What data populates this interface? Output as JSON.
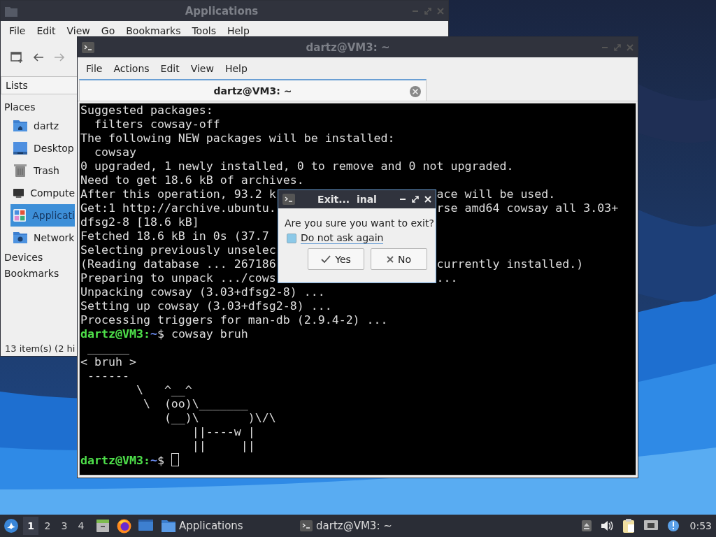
{
  "file_manager": {
    "title": "Applications",
    "menu": [
      "File",
      "Edit",
      "View",
      "Go",
      "Bookmarks",
      "Tools",
      "Help"
    ],
    "side_pane_mode": "Lists",
    "sidebar": [
      {
        "label": "Places",
        "items": [
          {
            "label": "dartz",
            "kind": "home",
            "selected": false
          },
          {
            "label": "Desktop",
            "kind": "desktop",
            "selected": false
          },
          {
            "label": "Trash",
            "kind": "trash",
            "selected": false
          },
          {
            "label": "Compute",
            "kind": "computer",
            "selected": false
          },
          {
            "label": "Applicati",
            "kind": "applications",
            "selected": true
          },
          {
            "label": "Network",
            "kind": "network",
            "selected": false
          }
        ]
      },
      {
        "label": "Devices"
      },
      {
        "label": "Bookmarks"
      }
    ],
    "status": "13 item(s) (2 hi"
  },
  "terminal": {
    "title": "dartz@VM3: ~",
    "menu": [
      "File",
      "Actions",
      "Edit",
      "View",
      "Help"
    ],
    "tabs": [
      {
        "label": "dartz@VM3: ~",
        "selected": true
      }
    ],
    "lines": [
      {
        "kind": "output",
        "text": "Suggested packages:"
      },
      {
        "kind": "output",
        "text": "  filters cowsay-off"
      },
      {
        "kind": "output",
        "text": "The following NEW packages will be installed:"
      },
      {
        "kind": "output",
        "text": "  cowsay"
      },
      {
        "kind": "output",
        "text": "0 upgraded, 1 newly installed, 0 to remove and 0 not upgraded."
      },
      {
        "kind": "output",
        "text": "Need to get 18.6 kB of archives."
      },
      {
        "kind": "output",
        "text": "After this operation, 93.2 k",
        "rest": "ace will be used."
      },
      {
        "kind": "output",
        "text": "Get:1 http://archive.ubuntu.",
        "rest": "rse amd64 cowsay all 3.03+"
      },
      {
        "kind": "output",
        "text": "dfsg2-8 [18.6 kB]"
      },
      {
        "kind": "output",
        "text": "Fetched 18.6 kB in 0s (37.7"
      },
      {
        "kind": "output",
        "text": "Selecting previously unselec"
      },
      {
        "kind": "output",
        "text": "(Reading database ... 267186",
        "rest": "currently installed.)"
      },
      {
        "kind": "output",
        "text": "Preparing to unpack .../cows",
        "rest": "..."
      },
      {
        "kind": "output",
        "text": "Unpacking cowsay (3.03+dfsg2-8) ..."
      },
      {
        "kind": "output",
        "text": "Setting up cowsay (3.03+dfsg2-8) ..."
      },
      {
        "kind": "output",
        "text": "Processing triggers for man-db (2.9.4-2) ..."
      },
      {
        "kind": "prompt",
        "user_host": "dartz@VM3:",
        "path": "~",
        "command": "$ cowsay bruh",
        "cursor": false
      },
      {
        "kind": "output",
        "text": " ______"
      },
      {
        "kind": "output",
        "text": "< bruh >"
      },
      {
        "kind": "output",
        "text": " ------"
      },
      {
        "kind": "output",
        "text": "        \\   ^__^"
      },
      {
        "kind": "output",
        "text": "         \\  (oo)\\_______"
      },
      {
        "kind": "output",
        "text": "            (__)\\       )\\/\\"
      },
      {
        "kind": "output",
        "text": "                ||----w |"
      },
      {
        "kind": "output",
        "text": "                ||     ||"
      },
      {
        "kind": "prompt",
        "user_host": "dartz@VM3:",
        "path": "~",
        "command": "$",
        "cursor": true
      }
    ]
  },
  "dialog": {
    "title": "Exit...  inal",
    "message": "Are you sure you want to exit?",
    "checkbox": {
      "label": "Do not ask again",
      "checked": false
    },
    "buttons": [
      {
        "label": "Yes",
        "kind": "yes"
      },
      {
        "label": "No",
        "kind": "no"
      }
    ]
  },
  "taskbar": {
    "workspaces": [
      {
        "label": "1",
        "selected": true
      },
      {
        "label": "2",
        "selected": false
      },
      {
        "label": "3",
        "selected": false
      },
      {
        "label": "4",
        "selected": false
      }
    ],
    "tasks": [
      {
        "label": "Applications",
        "kind": "folder"
      },
      {
        "label": "dartz@VM3: ~",
        "kind": "terminal"
      }
    ],
    "clock": "0:53"
  }
}
